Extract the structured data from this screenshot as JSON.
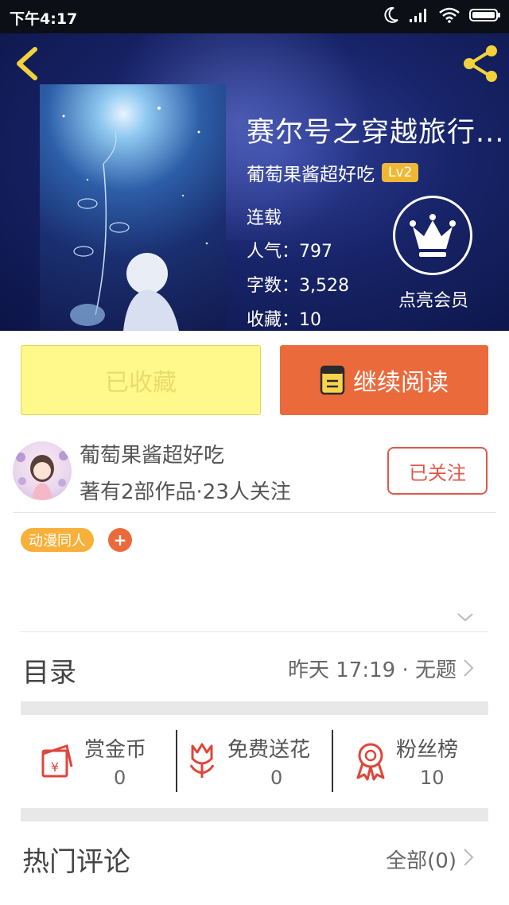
{
  "status": {
    "time": "下午4:17"
  },
  "book": {
    "title": "赛尔号之穿越旅行...",
    "author": "葡萄果酱超好吃",
    "level": "Lv2",
    "status": "连载",
    "popularity": "人气：797",
    "word_count": "字数：3,528",
    "favorites": "收藏：10",
    "member_label": "点亮会员"
  },
  "actions": {
    "favorited_label": "已收藏",
    "continue_label": "继续阅读"
  },
  "author_card": {
    "name": "葡萄果酱超好吃",
    "stats": "著有2部作品·23人关注",
    "follow_label": "已关注"
  },
  "tags": [
    "动漫同人"
  ],
  "tag_add": "+",
  "toc": {
    "label": "目录",
    "latest": "昨天 17:19 · 无题"
  },
  "stats": [
    {
      "label": "赏金币",
      "value": "0",
      "icon": "red-envelope-icon"
    },
    {
      "label": "免费送花",
      "value": "0",
      "icon": "flower-icon"
    },
    {
      "label": "粉丝榜",
      "value": "10",
      "icon": "medal-icon"
    }
  ],
  "comments": {
    "label": "热门评论",
    "all": "全部(0)"
  },
  "colors": {
    "accent_orange": "#eb6a3c",
    "favorite_yellow": "#fff88a",
    "follow_red": "#e0584a",
    "tag_orange": "#f7b03a",
    "icon_yellow": "#f2d23c",
    "hero_blue": "#182469"
  }
}
